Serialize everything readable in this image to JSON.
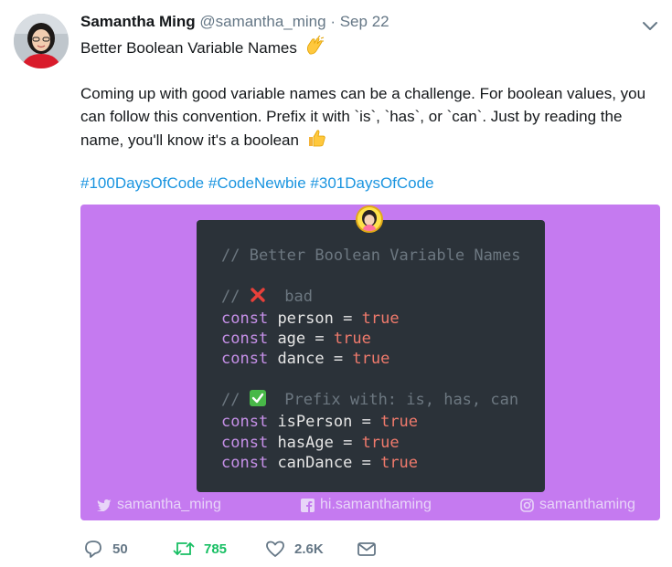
{
  "tweet": {
    "display_name": "Samantha Ming",
    "handle": "@samantha_ming",
    "separator": "·",
    "date": "Sep 22",
    "title": "Better Boolean Variable Names",
    "body": "Coming up with good variable names can be a challenge. For boolean values, you can follow this convention. Prefix it with `is`, `has`, or `can`. Just by reading the name, you'll know it's a boolean",
    "hashtags": [
      "#100DaysOfCode",
      "#CodeNewbie",
      "#301DaysOfCode"
    ]
  },
  "code_image": {
    "background_color": "#c57af0",
    "card_color": "#2b3239",
    "comment_title": "// Better Boolean Variable Names",
    "bad_comment_prefix": "//",
    "bad_comment_text": "bad",
    "good_comment_prefix": "//",
    "good_comment_text": "Prefix with: is, has, can",
    "keyword": "const",
    "operator": "=",
    "value": "true",
    "bad_vars": [
      "person",
      "age",
      "dance"
    ],
    "good_vars": [
      "isPerson",
      "hasAge",
      "canDance"
    ],
    "footer": {
      "twitter": "samantha_ming",
      "facebook": "hi.samanthaming",
      "instagram": "samanthaming"
    }
  },
  "actions": {
    "replies": "50",
    "retweets": "785",
    "likes": "2.6K"
  },
  "colors": {
    "link": "#1b95e0",
    "retweet_green": "#17bf63",
    "muted": "#657786"
  },
  "icons": {
    "caret": "chevron-down-icon",
    "reply": "reply-icon",
    "retweet": "retweet-icon",
    "like": "heart-icon",
    "dm": "envelope-icon",
    "clap": "clapping-hands-icon",
    "thumbs": "thumbs-up-icon",
    "cross": "cross-mark-icon",
    "check": "check-mark-icon"
  }
}
